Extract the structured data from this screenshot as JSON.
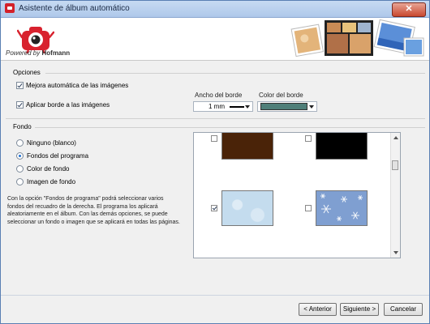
{
  "window": {
    "title": "Asistente de álbum automático",
    "close_glyph": "✕"
  },
  "header": {
    "powered_prefix": "Powered by",
    "brand": "Hofmann",
    "logo_icon": "camera-mascot-icon",
    "photos_icon": "photo-collage-icon"
  },
  "opciones": {
    "title": "Opciones",
    "mejora": {
      "label": "Mejora automática de las imágenes",
      "checked": true
    },
    "borde": {
      "label": "Aplicar borde a las imágenes",
      "checked": true
    },
    "ancho_label": "Ancho del borde",
    "ancho_value": "1 mm",
    "color_label": "Color del borde",
    "color_value": "#4f7f79"
  },
  "fondo": {
    "title": "Fondo",
    "options": [
      {
        "label": "Ninguno (blanco)",
        "selected": false
      },
      {
        "label": "Fondos del programa",
        "selected": true
      },
      {
        "label": "Color de fondo",
        "selected": false
      },
      {
        "label": "Imagen de fondo",
        "selected": false
      }
    ],
    "description": "Con la opción \"Fondos de programa\" podrá seleccionar varios fondos del recuadro de la derecha. El programa los aplicará aleatoriamente en el álbum. Con las demás opciones, se puede seleccionar un fondo o imagen que se aplicará en todas las páginas."
  },
  "gallery": {
    "items": [
      {
        "color": "#4a2308",
        "checked": false
      },
      {
        "color": "#000000",
        "checked": false
      },
      {
        "color": "#c4dcee",
        "checked": true
      },
      {
        "color": "#7f9fd1",
        "checked": false
      }
    ]
  },
  "buttons": {
    "back": "< Anterior",
    "next": "Siguiente >",
    "cancel": "Cancelar"
  }
}
